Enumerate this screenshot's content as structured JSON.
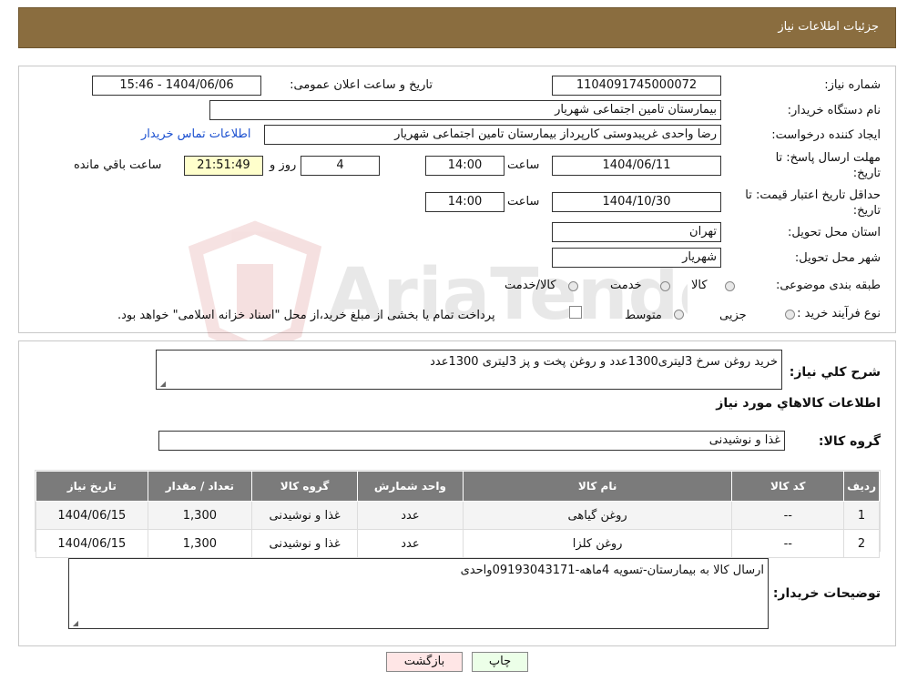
{
  "header": {
    "title": "جزئیات اطلاعات نیاز"
  },
  "form": {
    "need_number_label": "شماره نیاز:",
    "need_number": "1104091745000072",
    "announce_label": "تاریخ و ساعت اعلان عمومی:",
    "announce_value": "1404/06/06 - 15:46",
    "buyer_org_label": "نام دستگاه خریدار:",
    "buyer_org": "بیمارستان تامین اجتماعی شهریار",
    "creator_label": "ایجاد کننده درخواست:",
    "creator": "رضا واحدی غریبدوستی کارپرداز بیمارستان تامین اجتماعی شهریار",
    "contact_link": "اطلاعات تماس خریدار",
    "deadline_label_1": "مهلت ارسال پاسخ: تا",
    "deadline_label_2": "تاریخ:",
    "deadline_date": "1404/06/11",
    "time_label": "ساعت",
    "deadline_time": "14:00",
    "days_value": "4",
    "days_label": "روز و",
    "remaining_time": "21:51:49",
    "remaining_label": "ساعت باقي مانده",
    "validity_label_1": "حداقل تاریخ اعتبار قیمت: تا",
    "validity_label_2": "تاریخ:",
    "validity_date": "1404/10/30",
    "validity_time": "14:00",
    "province_label": "استان محل تحویل:",
    "province": "تهران",
    "city_label": "شهر محل تحویل:",
    "city": "شهریار",
    "category_label": "طبقه بندی موضوعی:",
    "category_options": [
      "کالا",
      "خدمت",
      "کالا/خدمت"
    ],
    "process_label": "نوع فرآیند خرید :",
    "process_options": [
      "جزیی",
      "متوسط"
    ],
    "process_note": "پرداخت تمام یا بخشی از مبلغ خرید،از محل \"اسناد خزانه اسلامی\" خواهد بود."
  },
  "description": {
    "label": "شرح کلي نياز:",
    "value": "خرید روغن سرخ 3لیتری1300عدد و روغن پخت و پز 3لیتری 1300عدد"
  },
  "goods": {
    "section_title": "اطلاعات کالاهاي مورد نياز",
    "group_label": "گروه کالا:",
    "group_value": "غذا و نوشیدنی",
    "columns": [
      "رديف",
      "کد کالا",
      "نام کالا",
      "واحد شمارش",
      "گروه کالا",
      "تعداد / مقدار",
      "تاريخ نياز"
    ],
    "rows": [
      [
        "1",
        "--",
        "روغن گیاهی",
        "عدد",
        "غذا و نوشیدنی",
        "1,300",
        "1404/06/15"
      ],
      [
        "2",
        "--",
        "روغن کلزا",
        "عدد",
        "غذا و نوشیدنی",
        "1,300",
        "1404/06/15"
      ]
    ]
  },
  "notes": {
    "label": "توضیحات خریدار:",
    "value": "ارسال کالا به بیمارستان-تسویه 4ماهه-09193043171واحدی"
  },
  "buttons": {
    "print": "چاپ",
    "back": "بازگشت"
  },
  "colors": {
    "header_bg": "#8a6d3f",
    "table_header_bg": "#7b7b7b",
    "link": "#1a4fd0",
    "remaining_bg": "#ffffcc",
    "back_button_bg": "#ffe6e6"
  }
}
